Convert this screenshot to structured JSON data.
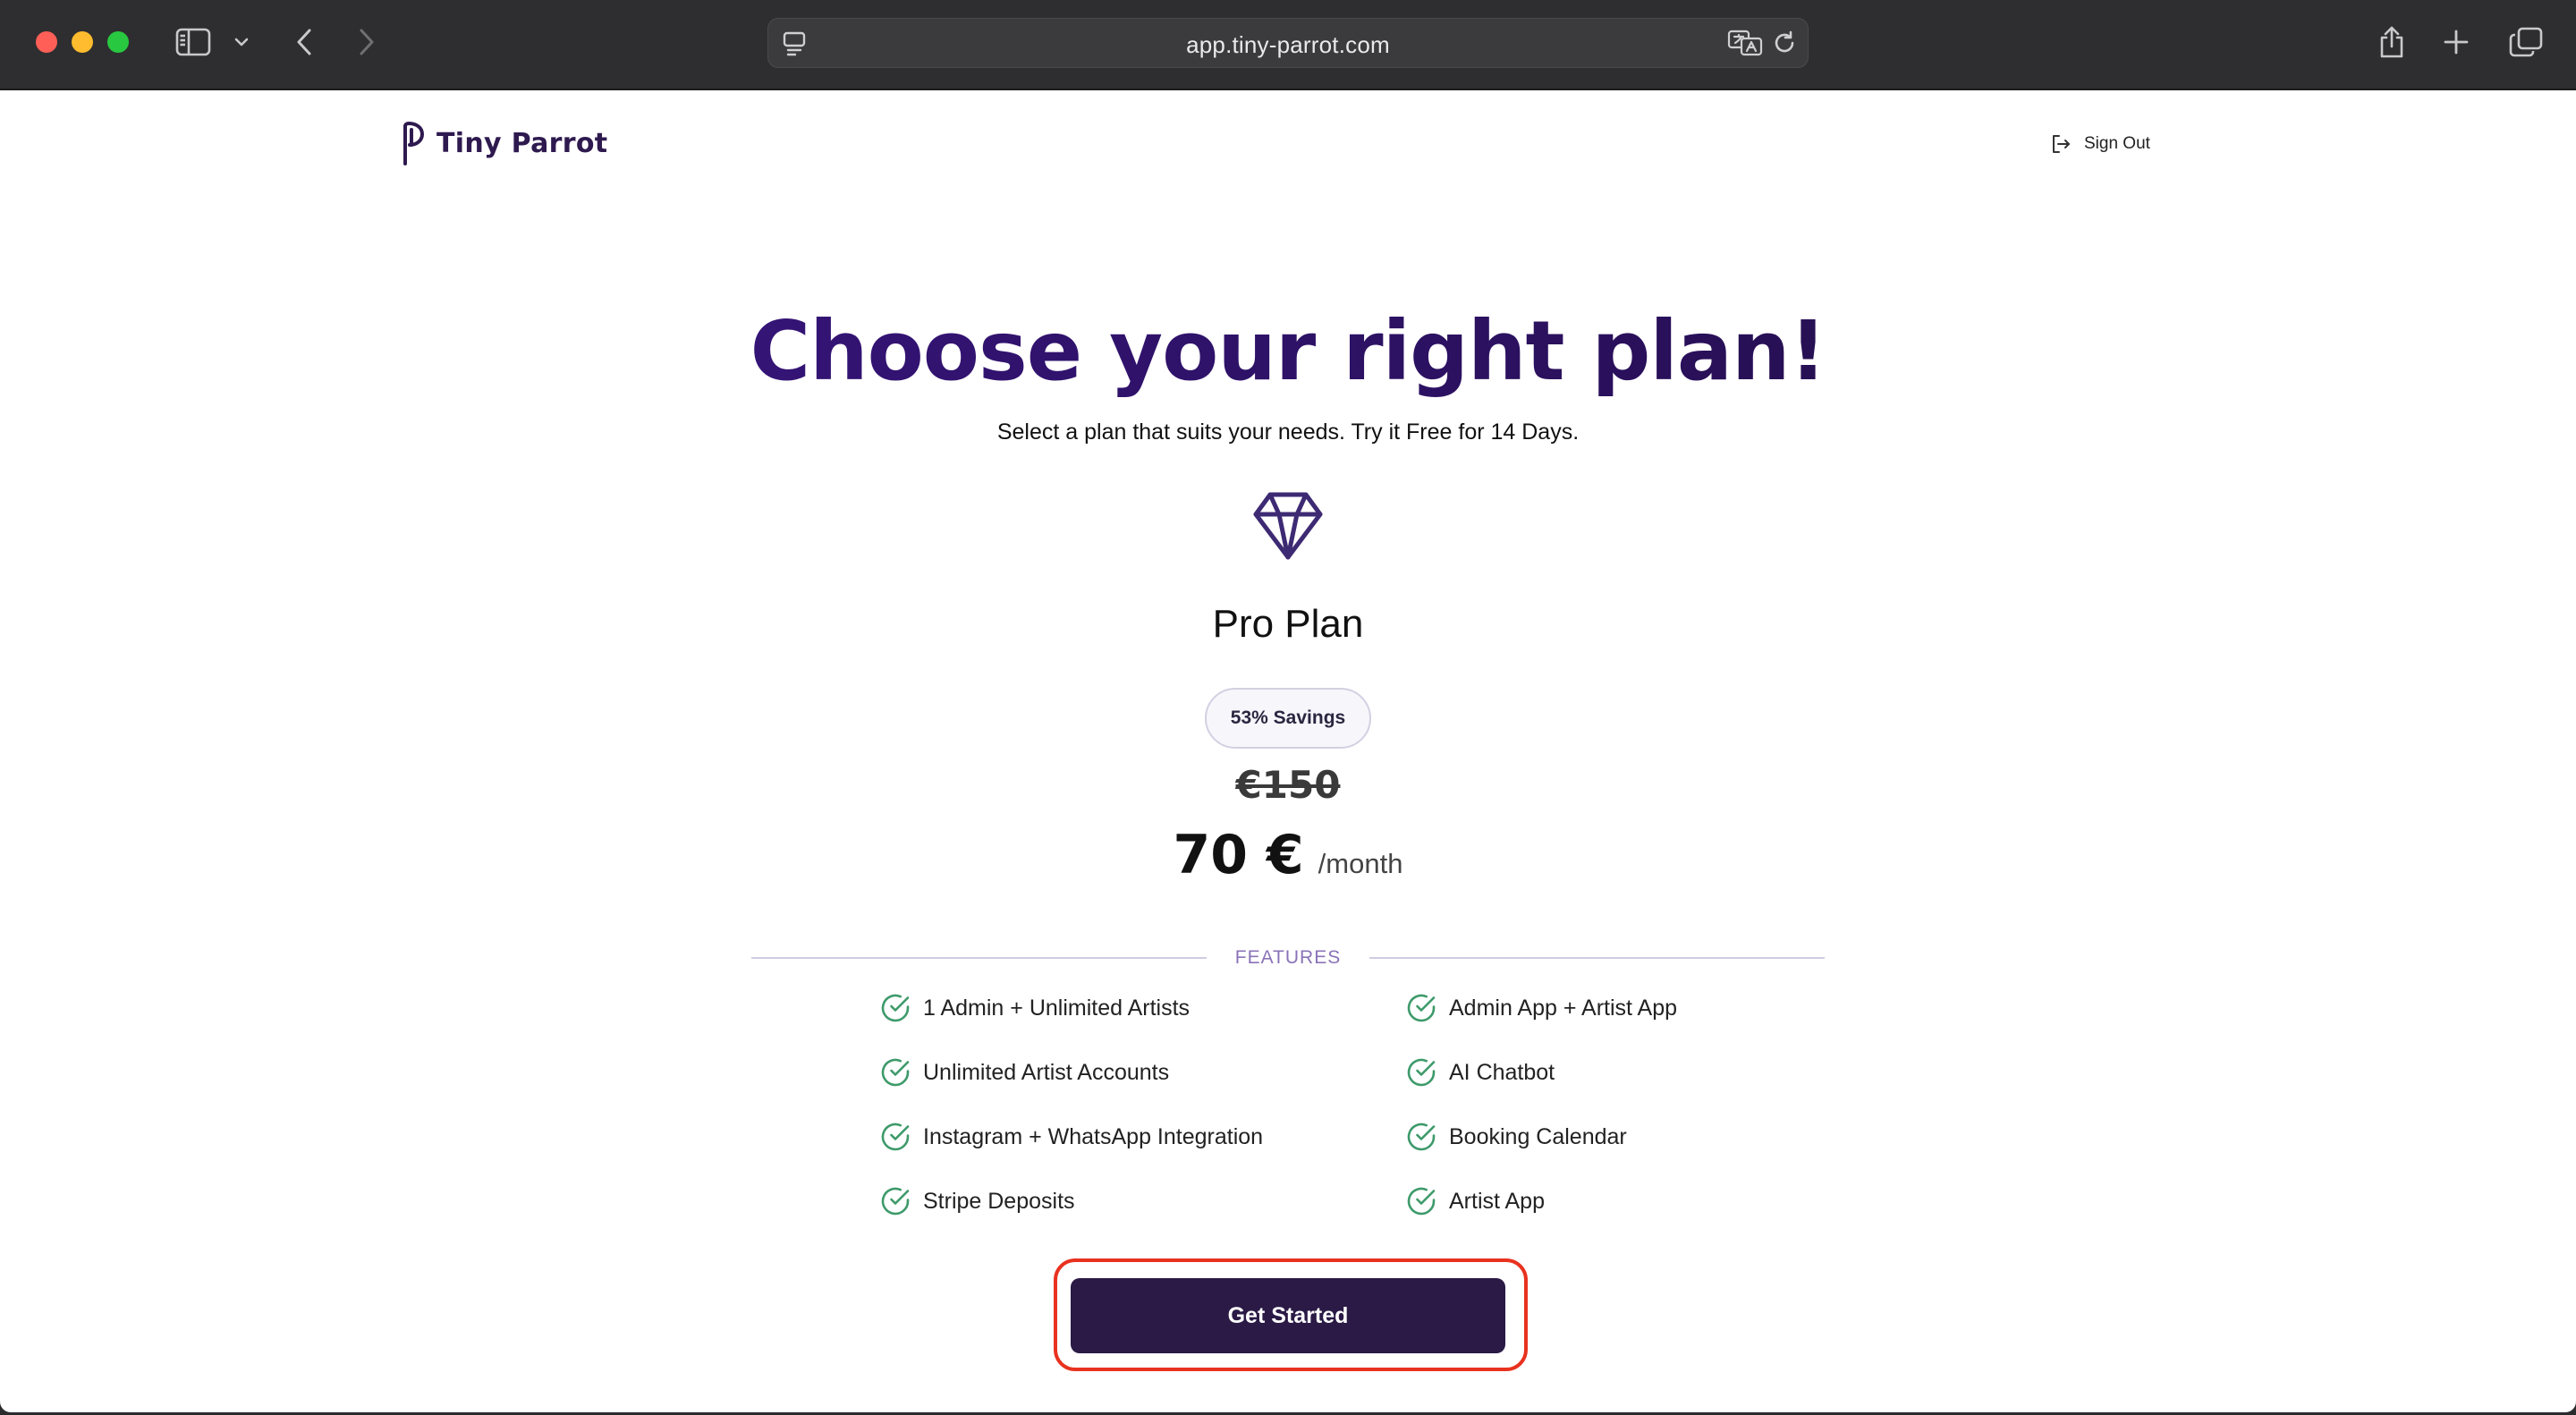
{
  "browser": {
    "url": "app.tiny-parrot.com"
  },
  "header": {
    "brand": "Tiny Parrot",
    "sign_out_label": "Sign Out"
  },
  "hero": {
    "title": "Choose your right plan!",
    "subtitle": "Select a plan that suits your needs. Try it Free for 14 Days."
  },
  "plan": {
    "name": "Pro Plan",
    "savings_badge": "53% Savings",
    "old_price": "€150",
    "price": "70 €",
    "period": "/month",
    "features_label": "FEATURES",
    "features_left": [
      "1 Admin + Unlimited Artists",
      "Unlimited Artist Accounts",
      "Instagram + WhatsApp Integration",
      "Stripe Deposits"
    ],
    "features_right": [
      "Admin App + Artist App",
      "AI Chatbot",
      "Booking Calendar",
      "Artist App"
    ],
    "cta_label": "Get Started"
  },
  "colors": {
    "brand": "#2e1a4f",
    "title_start": "#3a1480",
    "title_end": "#1e0c3a",
    "cta_bg": "#2a1a45",
    "check_green": "#3d9a6a",
    "highlight_red": "#e8321f"
  },
  "icons": {
    "sidebar": "sidebar-icon",
    "back": "chevron-left-icon",
    "forward": "chevron-right-icon",
    "site": "site-settings-icon",
    "translate": "translate-icon",
    "reload": "reload-icon",
    "share": "share-icon",
    "new_tab": "plus-icon",
    "tabs": "tab-overview-icon",
    "sign_out": "sign-out-icon",
    "plan": "diamond-icon",
    "feature": "check-circle-icon"
  }
}
